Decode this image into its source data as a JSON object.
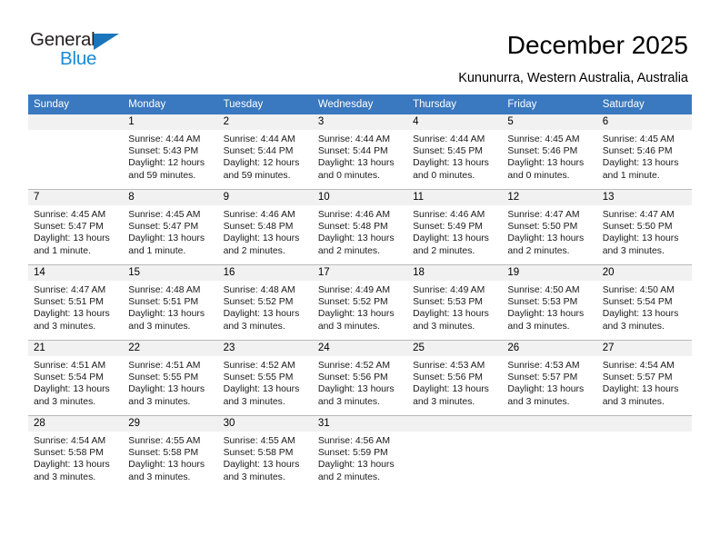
{
  "brand": {
    "name_top": "General",
    "name_bottom": "Blue",
    "triangle_color": "#1b75bb",
    "blue_color": "#1b8ad6"
  },
  "header": {
    "title": "December 2025",
    "subtitle": "Kununurra, Western Australia, Australia"
  },
  "theme": {
    "header_bg": "#3a78bf",
    "header_text": "#ffffff",
    "daynum_bg": "#f1f1f1",
    "cell_bg": "#ffffff",
    "grid_line": "#b9b9b9"
  },
  "weekday_headers": [
    "Sunday",
    "Monday",
    "Tuesday",
    "Wednesday",
    "Thursday",
    "Friday",
    "Saturday"
  ],
  "weeks": [
    [
      {
        "day": "",
        "empty": true,
        "sunrise": "",
        "sunset": "",
        "daylight_line1": "",
        "daylight_line2": ""
      },
      {
        "day": "1",
        "sunrise": "Sunrise: 4:44 AM",
        "sunset": "Sunset: 5:43 PM",
        "daylight_line1": "Daylight: 12 hours",
        "daylight_line2": "and 59 minutes."
      },
      {
        "day": "2",
        "sunrise": "Sunrise: 4:44 AM",
        "sunset": "Sunset: 5:44 PM",
        "daylight_line1": "Daylight: 12 hours",
        "daylight_line2": "and 59 minutes."
      },
      {
        "day": "3",
        "sunrise": "Sunrise: 4:44 AM",
        "sunset": "Sunset: 5:44 PM",
        "daylight_line1": "Daylight: 13 hours",
        "daylight_line2": "and 0 minutes."
      },
      {
        "day": "4",
        "sunrise": "Sunrise: 4:44 AM",
        "sunset": "Sunset: 5:45 PM",
        "daylight_line1": "Daylight: 13 hours",
        "daylight_line2": "and 0 minutes."
      },
      {
        "day": "5",
        "sunrise": "Sunrise: 4:45 AM",
        "sunset": "Sunset: 5:46 PM",
        "daylight_line1": "Daylight: 13 hours",
        "daylight_line2": "and 0 minutes."
      },
      {
        "day": "6",
        "sunrise": "Sunrise: 4:45 AM",
        "sunset": "Sunset: 5:46 PM",
        "daylight_line1": "Daylight: 13 hours",
        "daylight_line2": "and 1 minute."
      }
    ],
    [
      {
        "day": "7",
        "sunrise": "Sunrise: 4:45 AM",
        "sunset": "Sunset: 5:47 PM",
        "daylight_line1": "Daylight: 13 hours",
        "daylight_line2": "and 1 minute."
      },
      {
        "day": "8",
        "sunrise": "Sunrise: 4:45 AM",
        "sunset": "Sunset: 5:47 PM",
        "daylight_line1": "Daylight: 13 hours",
        "daylight_line2": "and 1 minute."
      },
      {
        "day": "9",
        "sunrise": "Sunrise: 4:46 AM",
        "sunset": "Sunset: 5:48 PM",
        "daylight_line1": "Daylight: 13 hours",
        "daylight_line2": "and 2 minutes."
      },
      {
        "day": "10",
        "sunrise": "Sunrise: 4:46 AM",
        "sunset": "Sunset: 5:48 PM",
        "daylight_line1": "Daylight: 13 hours",
        "daylight_line2": "and 2 minutes."
      },
      {
        "day": "11",
        "sunrise": "Sunrise: 4:46 AM",
        "sunset": "Sunset: 5:49 PM",
        "daylight_line1": "Daylight: 13 hours",
        "daylight_line2": "and 2 minutes."
      },
      {
        "day": "12",
        "sunrise": "Sunrise: 4:47 AM",
        "sunset": "Sunset: 5:50 PM",
        "daylight_line1": "Daylight: 13 hours",
        "daylight_line2": "and 2 minutes."
      },
      {
        "day": "13",
        "sunrise": "Sunrise: 4:47 AM",
        "sunset": "Sunset: 5:50 PM",
        "daylight_line1": "Daylight: 13 hours",
        "daylight_line2": "and 3 minutes."
      }
    ],
    [
      {
        "day": "14",
        "sunrise": "Sunrise: 4:47 AM",
        "sunset": "Sunset: 5:51 PM",
        "daylight_line1": "Daylight: 13 hours",
        "daylight_line2": "and 3 minutes."
      },
      {
        "day": "15",
        "sunrise": "Sunrise: 4:48 AM",
        "sunset": "Sunset: 5:51 PM",
        "daylight_line1": "Daylight: 13 hours",
        "daylight_line2": "and 3 minutes."
      },
      {
        "day": "16",
        "sunrise": "Sunrise: 4:48 AM",
        "sunset": "Sunset: 5:52 PM",
        "daylight_line1": "Daylight: 13 hours",
        "daylight_line2": "and 3 minutes."
      },
      {
        "day": "17",
        "sunrise": "Sunrise: 4:49 AM",
        "sunset": "Sunset: 5:52 PM",
        "daylight_line1": "Daylight: 13 hours",
        "daylight_line2": "and 3 minutes."
      },
      {
        "day": "18",
        "sunrise": "Sunrise: 4:49 AM",
        "sunset": "Sunset: 5:53 PM",
        "daylight_line1": "Daylight: 13 hours",
        "daylight_line2": "and 3 minutes."
      },
      {
        "day": "19",
        "sunrise": "Sunrise: 4:50 AM",
        "sunset": "Sunset: 5:53 PM",
        "daylight_line1": "Daylight: 13 hours",
        "daylight_line2": "and 3 minutes."
      },
      {
        "day": "20",
        "sunrise": "Sunrise: 4:50 AM",
        "sunset": "Sunset: 5:54 PM",
        "daylight_line1": "Daylight: 13 hours",
        "daylight_line2": "and 3 minutes."
      }
    ],
    [
      {
        "day": "21",
        "sunrise": "Sunrise: 4:51 AM",
        "sunset": "Sunset: 5:54 PM",
        "daylight_line1": "Daylight: 13 hours",
        "daylight_line2": "and 3 minutes."
      },
      {
        "day": "22",
        "sunrise": "Sunrise: 4:51 AM",
        "sunset": "Sunset: 5:55 PM",
        "daylight_line1": "Daylight: 13 hours",
        "daylight_line2": "and 3 minutes."
      },
      {
        "day": "23",
        "sunrise": "Sunrise: 4:52 AM",
        "sunset": "Sunset: 5:55 PM",
        "daylight_line1": "Daylight: 13 hours",
        "daylight_line2": "and 3 minutes."
      },
      {
        "day": "24",
        "sunrise": "Sunrise: 4:52 AM",
        "sunset": "Sunset: 5:56 PM",
        "daylight_line1": "Daylight: 13 hours",
        "daylight_line2": "and 3 minutes."
      },
      {
        "day": "25",
        "sunrise": "Sunrise: 4:53 AM",
        "sunset": "Sunset: 5:56 PM",
        "daylight_line1": "Daylight: 13 hours",
        "daylight_line2": "and 3 minutes."
      },
      {
        "day": "26",
        "sunrise": "Sunrise: 4:53 AM",
        "sunset": "Sunset: 5:57 PM",
        "daylight_line1": "Daylight: 13 hours",
        "daylight_line2": "and 3 minutes."
      },
      {
        "day": "27",
        "sunrise": "Sunrise: 4:54 AM",
        "sunset": "Sunset: 5:57 PM",
        "daylight_line1": "Daylight: 13 hours",
        "daylight_line2": "and 3 minutes."
      }
    ],
    [
      {
        "day": "28",
        "sunrise": "Sunrise: 4:54 AM",
        "sunset": "Sunset: 5:58 PM",
        "daylight_line1": "Daylight: 13 hours",
        "daylight_line2": "and 3 minutes."
      },
      {
        "day": "29",
        "sunrise": "Sunrise: 4:55 AM",
        "sunset": "Sunset: 5:58 PM",
        "daylight_line1": "Daylight: 13 hours",
        "daylight_line2": "and 3 minutes."
      },
      {
        "day": "30",
        "sunrise": "Sunrise: 4:55 AM",
        "sunset": "Sunset: 5:58 PM",
        "daylight_line1": "Daylight: 13 hours",
        "daylight_line2": "and 3 minutes."
      },
      {
        "day": "31",
        "sunrise": "Sunrise: 4:56 AM",
        "sunset": "Sunset: 5:59 PM",
        "daylight_line1": "Daylight: 13 hours",
        "daylight_line2": "and 2 minutes."
      },
      {
        "day": "",
        "empty": true,
        "sunrise": "",
        "sunset": "",
        "daylight_line1": "",
        "daylight_line2": ""
      },
      {
        "day": "",
        "empty": true,
        "sunrise": "",
        "sunset": "",
        "daylight_line1": "",
        "daylight_line2": ""
      },
      {
        "day": "",
        "empty": true,
        "sunrise": "",
        "sunset": "",
        "daylight_line1": "",
        "daylight_line2": ""
      }
    ]
  ]
}
